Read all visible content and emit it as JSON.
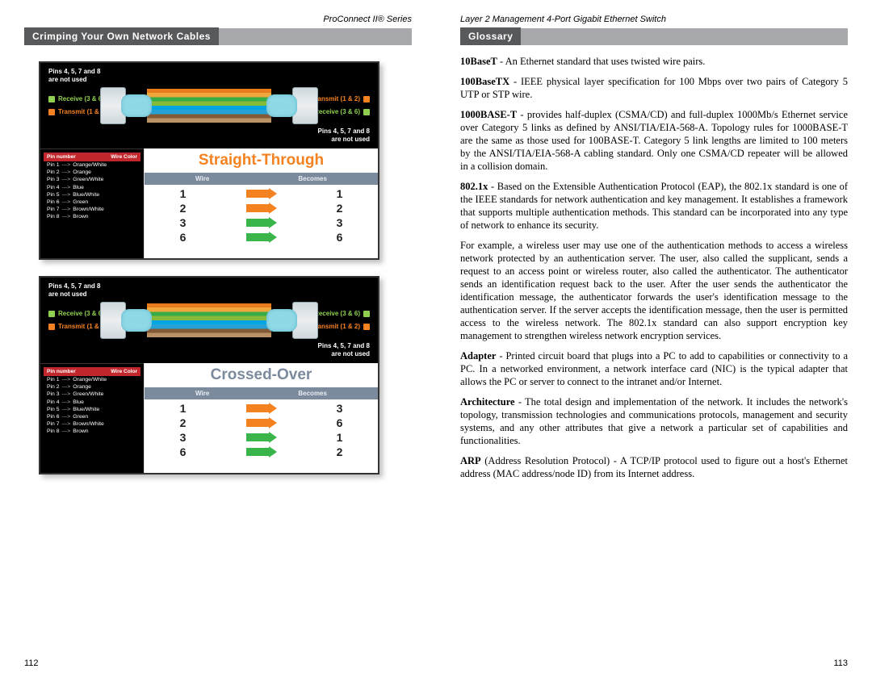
{
  "left": {
    "header": "ProConnect II® Series",
    "section_title": "Crimping Your Own Network Cables",
    "pagenum": "112",
    "cable_notes": {
      "top": "Pins 4, 5, 7 and 8\nare not used"
    },
    "signals": {
      "receive": "Receive (3 & 6)",
      "transmit": "Transmit (1 & 2)"
    },
    "pin_header": {
      "a": "Pin number",
      "b": "Wire Color"
    },
    "pins": [
      {
        "p": "Pin 1",
        "c": "Orange/White"
      },
      {
        "p": "Pin 2",
        "c": "Orange"
      },
      {
        "p": "Pin 3",
        "c": "Green/White"
      },
      {
        "p": "Pin 4",
        "c": "Blue"
      },
      {
        "p": "Pin 5",
        "c": "Blue/White"
      },
      {
        "p": "Pin 6",
        "c": "Green"
      },
      {
        "p": "Pin 7",
        "c": "Brown/White"
      },
      {
        "p": "Pin 8",
        "c": "Brown"
      }
    ],
    "map_header": {
      "a": "Wire",
      "b": "Becomes"
    },
    "straight": {
      "title": "Straight-Through",
      "rows": [
        {
          "l": "1",
          "r": "1",
          "c": "a-orange"
        },
        {
          "l": "2",
          "r": "2",
          "c": "a-orange"
        },
        {
          "l": "3",
          "r": "3",
          "c": "a-green"
        },
        {
          "l": "6",
          "r": "6",
          "c": "a-green"
        }
      ]
    },
    "crossed": {
      "title": "Crossed-Over",
      "rows": [
        {
          "l": "1",
          "r": "3",
          "c": "a-orange"
        },
        {
          "l": "2",
          "r": "6",
          "c": "a-orange"
        },
        {
          "l": "3",
          "r": "1",
          "c": "a-green"
        },
        {
          "l": "6",
          "r": "2",
          "c": "a-green"
        }
      ]
    }
  },
  "right": {
    "header": "Layer 2 Management 4-Port Gigabit Ethernet Switch",
    "section_title": "Glossary",
    "pagenum": "113",
    "entries": [
      {
        "term": "10BaseT",
        "text": " - An Ethernet standard that uses twisted wire pairs."
      },
      {
        "term": "100BaseTX",
        "text": " - IEEE physical layer specification for 100 Mbps over two pairs of Category 5 UTP or STP wire."
      },
      {
        "term": "1000BASE-T",
        "text": " - provides half-duplex (CSMA/CD) and full-duplex 1000Mb/s Ethernet service over Category 5 links as defined by ANSI/TIA/EIA-568-A. Topology rules for 1000BASE-T are the same as those used for 100BASE-T. Category 5 link lengths are limited to 100 meters by the ANSI/TIA/EIA-568-A cabling standard. Only one CSMA/CD repeater will be allowed in a collision domain."
      },
      {
        "term": "802.1x",
        "text": " - Based on the Extensible Authentication Protocol (EAP), the 802.1x standard is one of the IEEE standards for network authentication and key management. It establishes a framework that supports multiple authentication methods. This standard can be incorporated into any type of network to enhance its security."
      },
      {
        "term": "",
        "text": "For example, a wireless user may use one of the authentication methods to access a wireless network protected by an authentication server. The user, also called the supplicant, sends a request to an access point or wireless router, also called the authenticator. The authenticator sends an identification request back to the user. After the user sends the authenticator the identification message, the authenticator forwards the user's identification message to the authentication server. If the server accepts the identification message, then the user is permitted access to the wireless network. The 802.1x standard can also support encryption key management to strengthen wireless network encryption services."
      },
      {
        "term": "Adapter",
        "text": " - Printed circuit board that plugs into a PC to add to capabilities or connectivity to a PC. In a networked environment, a network interface card (NIC) is the typical adapter that allows the PC or server to connect to the intranet and/or Internet."
      },
      {
        "term": "Architecture",
        "text": " - The total design and implementation of the network. It includes the network's topology, transmission technologies and communications protocols, management and security systems, and any other attributes that give a network a particular set of capabilities and functionalities."
      },
      {
        "term": "ARP",
        "text": " (Address Resolution Protocol) - A TCP/IP protocol used to figure out a host's Ethernet address (MAC address/node ID) from its Internet address."
      }
    ]
  }
}
